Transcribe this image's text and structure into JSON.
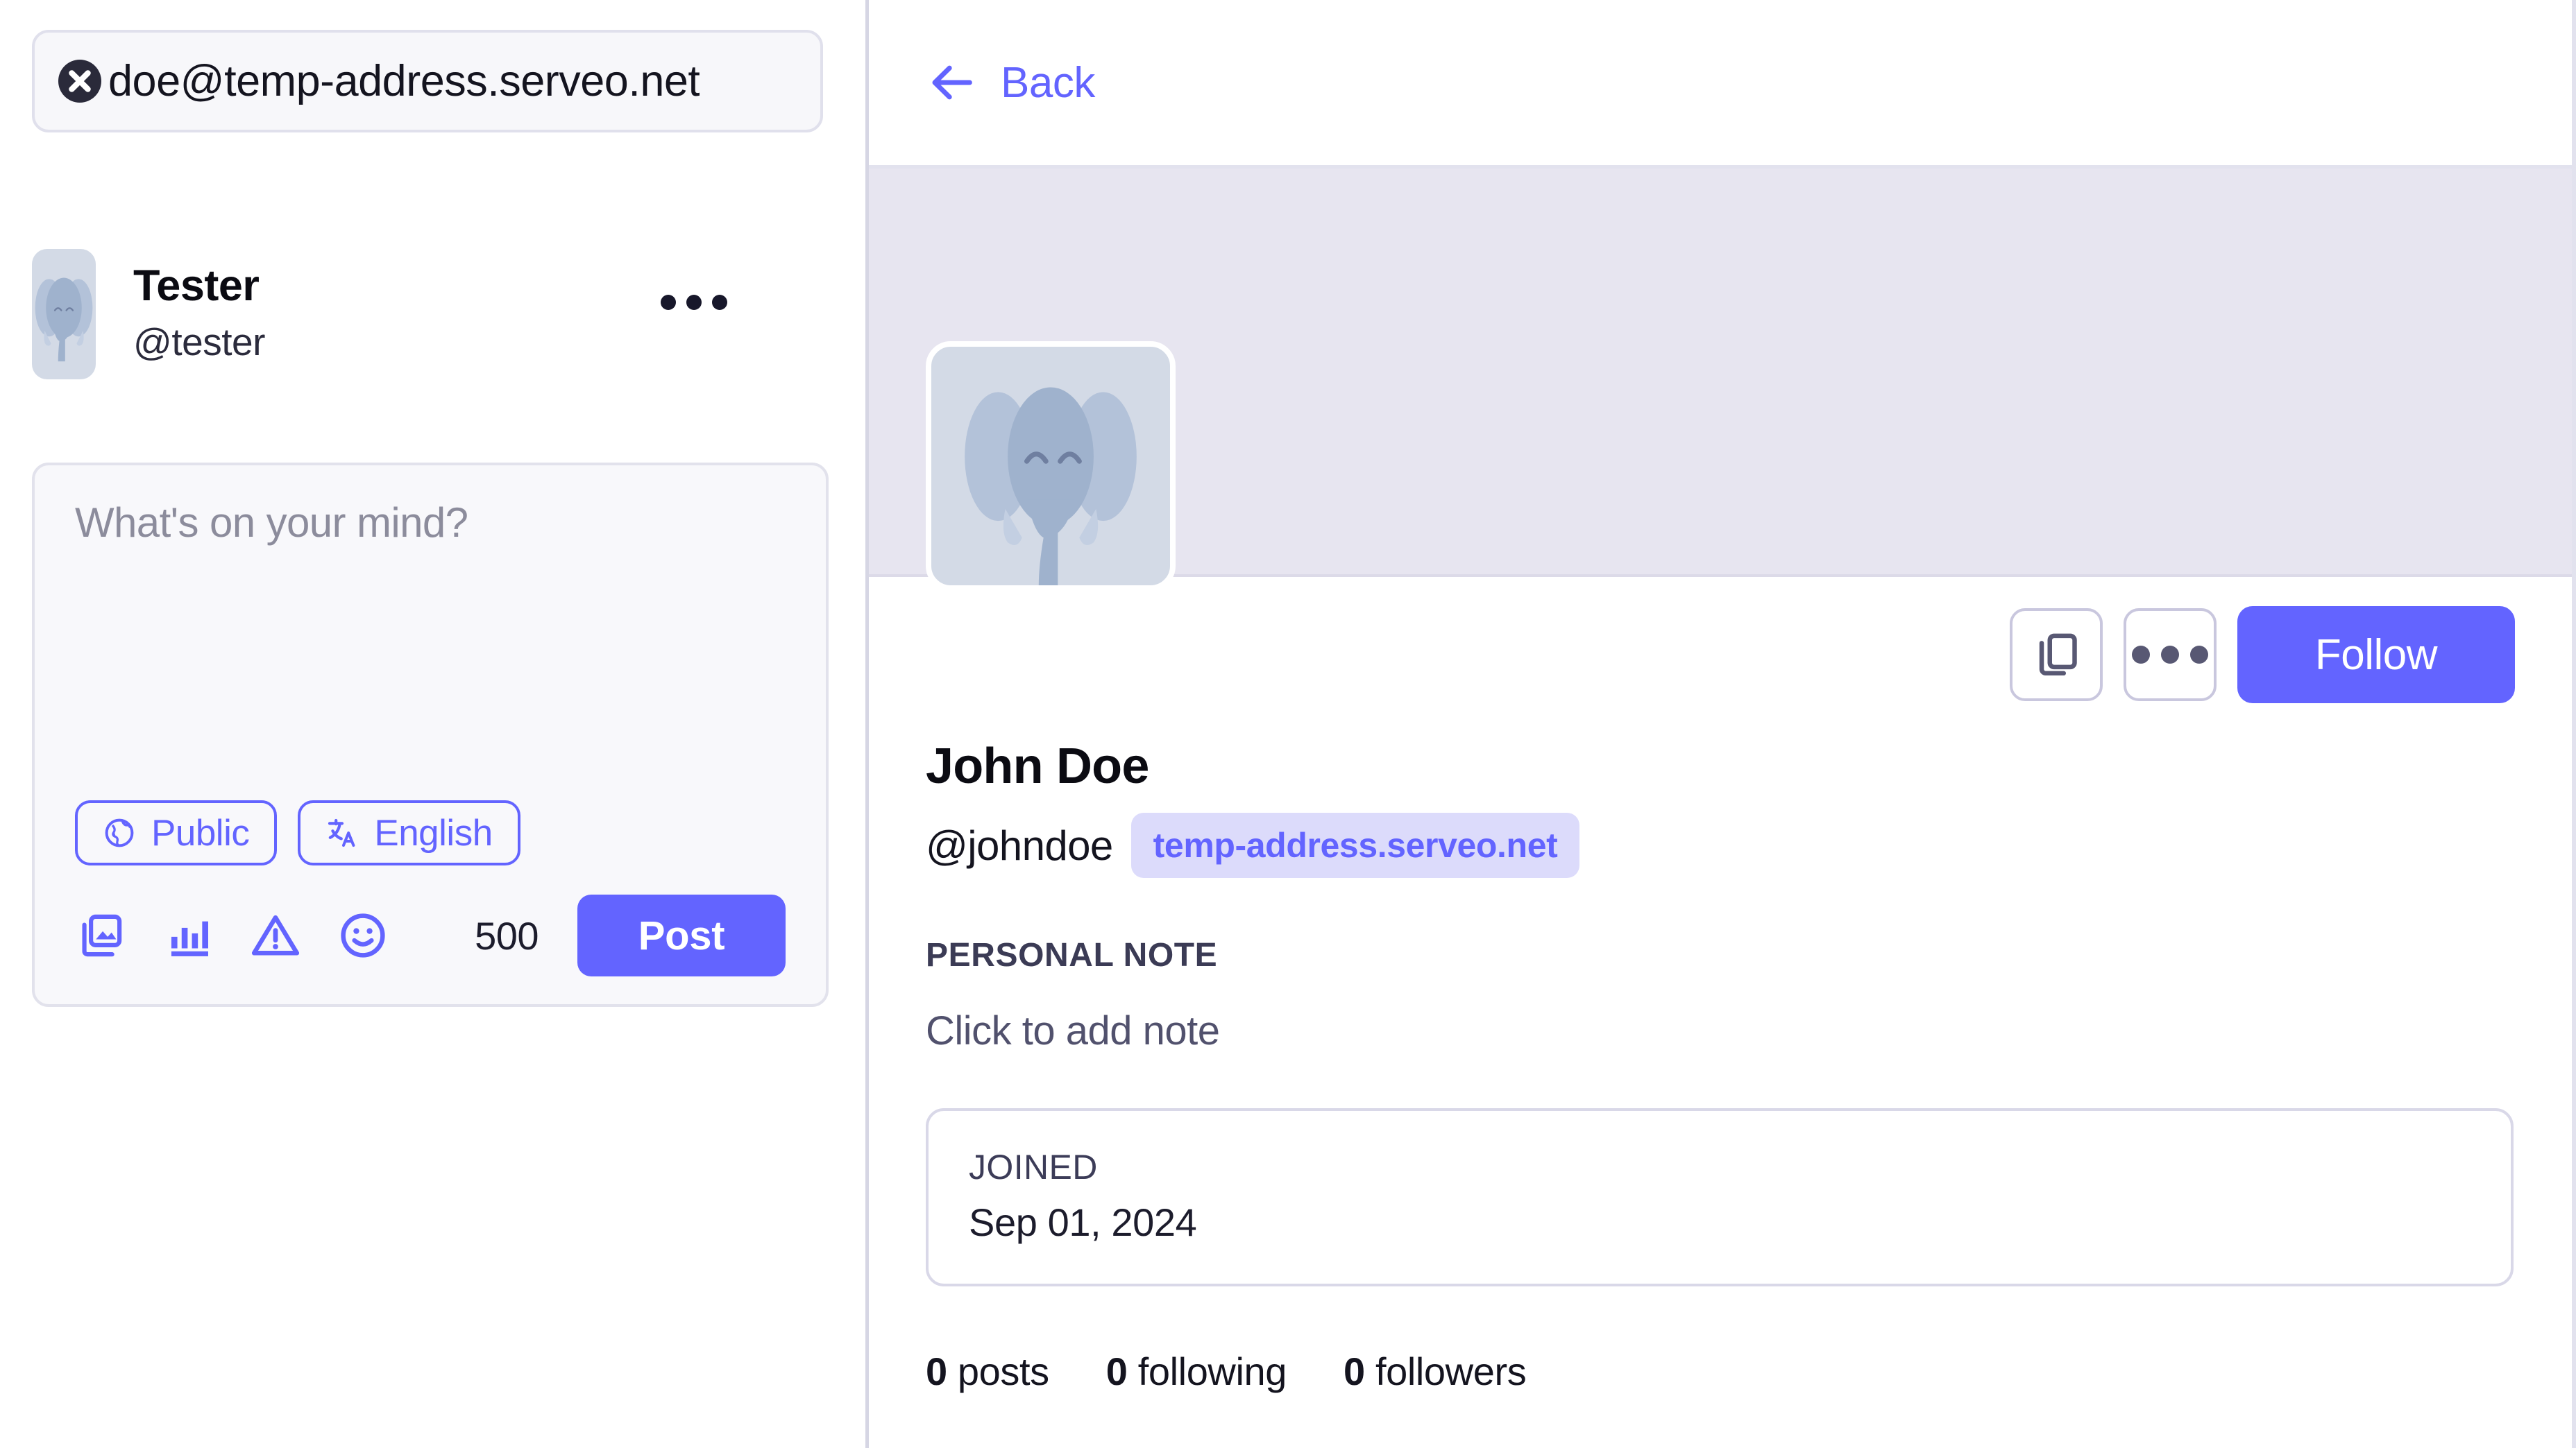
{
  "sidebar": {
    "search": {
      "value": "doe@temp-address.serveo.net",
      "clear_icon": "close-circle-icon"
    },
    "account": {
      "display_name": "Tester",
      "handle": "@tester",
      "avatar_icon": "elephant-avatar",
      "more_label": "more-options"
    },
    "composer": {
      "placeholder": "What's on your mind?",
      "visibility_label": "Public",
      "visibility_icon": "globe-icon",
      "language_label": "English",
      "language_icon": "translate-icon",
      "tools": [
        {
          "name": "add-media-icon"
        },
        {
          "name": "add-poll-icon"
        },
        {
          "name": "content-warning-icon"
        },
        {
          "name": "emoji-icon"
        }
      ],
      "char_count": "500",
      "post_label": "Post"
    }
  },
  "profile": {
    "back_label": "Back",
    "back_icon": "arrow-left-icon",
    "avatar_icon": "elephant-avatar",
    "actions": {
      "copy_icon": "copy-link-icon",
      "more_icon": "more-horizontal-icon",
      "follow_label": "Follow"
    },
    "display_name": "John Doe",
    "handle": "@johndoe",
    "domain_badge": "temp-address.serveo.net",
    "note_section_label": "PERSONAL NOTE",
    "note_placeholder": "Click to add note",
    "joined": {
      "label": "JOINED",
      "value": "Sep 01, 2024"
    },
    "stats": [
      {
        "count": "0",
        "label": "posts"
      },
      {
        "count": "0",
        "label": "following"
      },
      {
        "count": "0",
        "label": "followers"
      }
    ]
  },
  "colors": {
    "accent": "#6364ff",
    "banner": "#e7e5f0",
    "badge_bg": "#dcdbfb",
    "border": "#e2e2ee",
    "avatar_bg": "#d3dae6"
  }
}
